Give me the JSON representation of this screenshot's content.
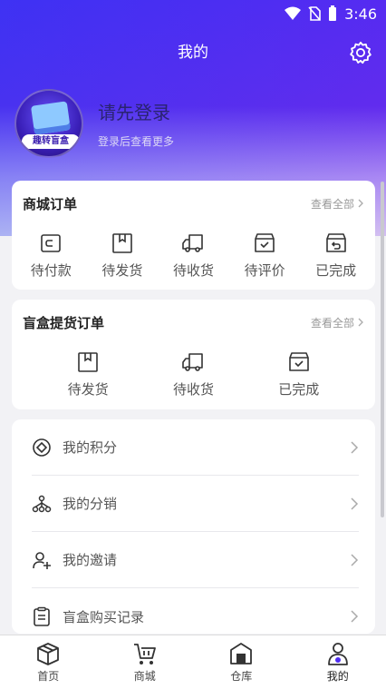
{
  "status_bar": {
    "time": "3:46"
  },
  "header": {
    "title": "我的"
  },
  "profile": {
    "avatar_text": "趣转盲盒",
    "login_title": "请先登录",
    "login_sub": "登录后查看更多"
  },
  "mall_orders": {
    "title": "商城订单",
    "view_all": "查看全部",
    "items": [
      {
        "label": "待付款",
        "icon": "wallet-icon"
      },
      {
        "label": "待发货",
        "icon": "box-icon"
      },
      {
        "label": "待收货",
        "icon": "truck-icon"
      },
      {
        "label": "待评价",
        "icon": "review-box-icon"
      },
      {
        "label": "已完成",
        "icon": "return-box-icon"
      }
    ]
  },
  "blindbox_orders": {
    "title": "盲盒提货订单",
    "view_all": "查看全部",
    "items": [
      {
        "label": "待发货",
        "icon": "box-icon"
      },
      {
        "label": "待收货",
        "icon": "truck-icon"
      },
      {
        "label": "已完成",
        "icon": "check-box-icon"
      }
    ]
  },
  "menu": {
    "items": [
      {
        "label": "我的积分",
        "icon": "points-icon"
      },
      {
        "label": "我的分销",
        "icon": "distribution-icon"
      },
      {
        "label": "我的邀请",
        "icon": "invite-user-icon"
      },
      {
        "label": "盲盒购买记录",
        "icon": "clipboard-icon"
      }
    ]
  },
  "tabbar": {
    "items": [
      {
        "label": "首页",
        "icon": "home-box-icon"
      },
      {
        "label": "商城",
        "icon": "cart-icon"
      },
      {
        "label": "仓库",
        "icon": "warehouse-icon"
      },
      {
        "label": "我的",
        "icon": "user-icon",
        "active": true
      }
    ]
  },
  "colors": {
    "accent": "#4f2df2",
    "brand_dark": "#2a2370"
  }
}
